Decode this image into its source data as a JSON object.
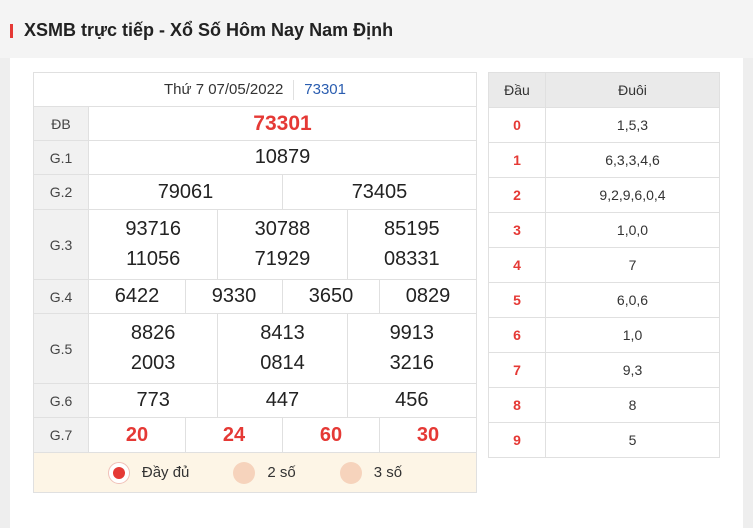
{
  "header": {
    "title": "XSMB trực tiếp - Xổ Số Hôm Nay Nam Định"
  },
  "results": {
    "date": "Thứ 7 07/05/2022",
    "code": "73301",
    "db": {
      "label": "ĐB",
      "values": [
        "73301"
      ]
    },
    "g1": {
      "label": "G.1",
      "values": [
        "10879"
      ]
    },
    "g2": {
      "label": "G.2",
      "values": [
        "79061",
        "73405"
      ]
    },
    "g3": {
      "label": "G.3",
      "values": [
        "93716",
        "30788",
        "85195",
        "11056",
        "71929",
        "08331"
      ]
    },
    "g4": {
      "label": "G.4",
      "values": [
        "6422",
        "9330",
        "3650",
        "0829"
      ]
    },
    "g5": {
      "label": "G.5",
      "values": [
        "8826",
        "8413",
        "9913",
        "2003",
        "0814",
        "3216"
      ]
    },
    "g6": {
      "label": "G.6",
      "values": [
        "773",
        "447",
        "456"
      ]
    },
    "g7": {
      "label": "G.7",
      "values": [
        "20",
        "24",
        "60",
        "30"
      ]
    }
  },
  "options": [
    {
      "label": "Đầy đủ",
      "selected": true
    },
    {
      "label": "2 số",
      "selected": false
    },
    {
      "label": "3 số",
      "selected": false
    }
  ],
  "loto": {
    "head_dau": "Đầu",
    "head_duoi": "Đuôi",
    "rows": [
      {
        "dau": "0",
        "duoi": "1,5,3"
      },
      {
        "dau": "1",
        "duoi": "6,3,3,4,6"
      },
      {
        "dau": "2",
        "duoi": "9,2,9,6,0,4"
      },
      {
        "dau": "3",
        "duoi": "1,0,0"
      },
      {
        "dau": "4",
        "duoi": "7"
      },
      {
        "dau": "5",
        "duoi": "6,0,6"
      },
      {
        "dau": "6",
        "duoi": "1,0"
      },
      {
        "dau": "7",
        "duoi": "9,3"
      },
      {
        "dau": "8",
        "duoi": "8"
      },
      {
        "dau": "9",
        "duoi": "5"
      }
    ]
  },
  "colors": {
    "accent_red": "#e53935",
    "code_blue": "#2a5db0",
    "option_bg": "#fdf5e6"
  }
}
